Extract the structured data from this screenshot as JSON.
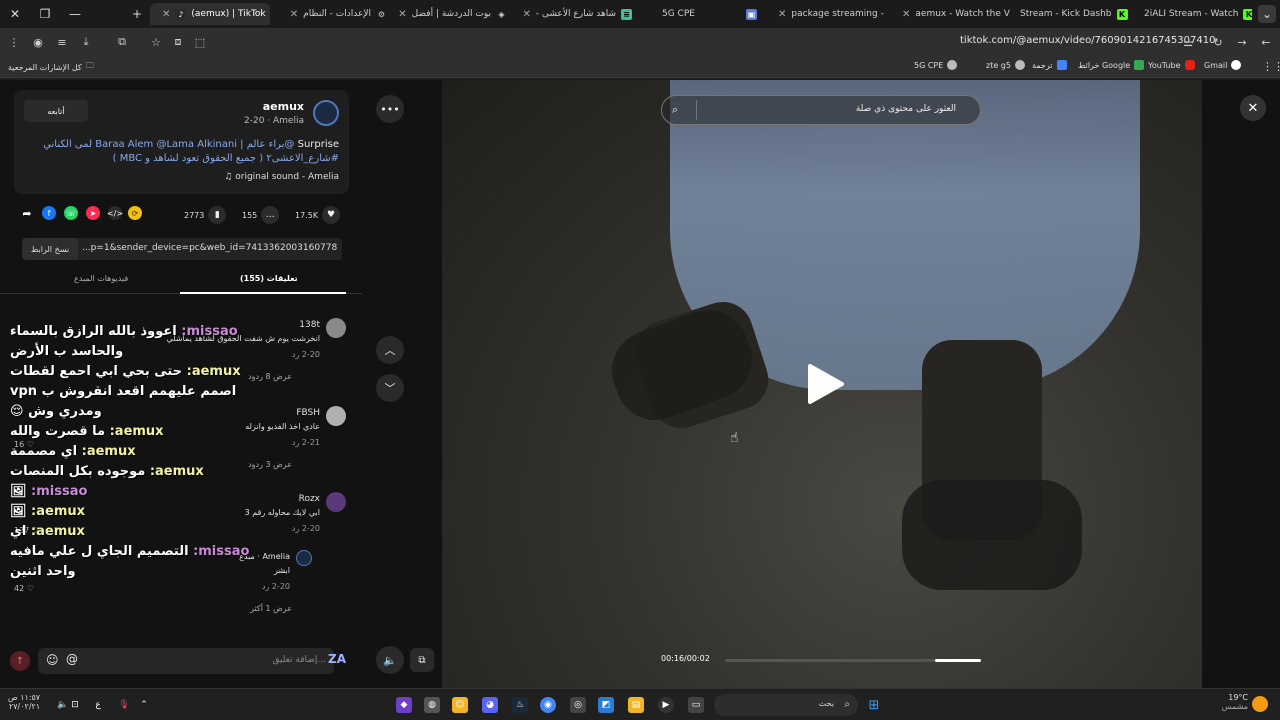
{
  "tabs": [
    {
      "title": "(aemux) | TikTok",
      "active": true
    },
    {
      "title": "الإعدادات - النظام"
    },
    {
      "title": "بوت الدردشة | أفضل"
    },
    {
      "title": "شاهد شارع الأعشى -"
    },
    {
      "title": "5G CPE"
    },
    {
      "title": "package streaming -"
    },
    {
      "title": "aemux - Watch the V"
    },
    {
      "title": "Stream - Kick Dashb"
    },
    {
      "title": "2iALI Stream - Watch"
    }
  ],
  "address": {
    "url": "tiktok.com/@aemux/video/7609014216745307410"
  },
  "bookmarks": {
    "all": "كل الإشارات المرجعية",
    "items": [
      "Gmail",
      "YouTube",
      "خرائط Google",
      "ترجمة",
      "zte g5",
      "5G CPE"
    ]
  },
  "post": {
    "follow_label": "أتابعه",
    "username": "aemux",
    "subline": "2-20 · Amelia",
    "desc_line1_plain": "Surprise ",
    "desc_line1_link": "@براء عالم | Baraa Alem @Lama Alkinani",
    "desc_line1_tail": " لمى الكناني",
    "desc_line2": "#شارع_الاعشى٢ ( جميع الحقوق تعود لشاهد و MBC )",
    "sound": "original sound - Amelia"
  },
  "actions": {
    "likes": "17.5K",
    "comments": "155",
    "saves": "2773"
  },
  "link": {
    "copy_label": "نسخ الرابط",
    "text": "...p=1&sender_device=pc&web_id=7413362003160778245"
  },
  "panel_tabs": {
    "comments": "تعليقات (155)",
    "creator_videos": "فيديوهات المبدع"
  },
  "comments": [
    {
      "user": "138t",
      "text": "انخرشت يوم ش شفت الحقوق لشاهد يماشلي",
      "date": "2-20",
      "reply": "رد",
      "more": "عرض 8 ردود"
    },
    {
      "user": "FBSH",
      "text": "عادي اخذ الفديو وانزله",
      "date": "2-21",
      "reply": "رد",
      "more": "عرض 3 ردود",
      "likes": "16"
    },
    {
      "user": "Rozx",
      "text": "ابي لايك محاوله رقم 3",
      "date": "2-20",
      "reply": "رد",
      "likes": "127"
    },
    {
      "user": "Amelia · مبدع",
      "text": "ابشر",
      "date": "2-20",
      "reply": "رد",
      "more": "عرض 1 أكثر",
      "likes": "42"
    }
  ],
  "chat_overlay": [
    {
      "name": "missao:",
      "msg": "اعووذ بالله الرازق بالسماء",
      "color": "purple"
    },
    {
      "name": "",
      "msg": "والحاسد ب الأرض",
      "color": "none"
    },
    {
      "name": "aemux:",
      "msg": "حتى بحي ابي احمع لقطات",
      "color": "yellow"
    },
    {
      "name": "",
      "msg": "اصمم عليهمم اقعد انقروش ب vpn",
      "color": "none"
    },
    {
      "name": "",
      "msg": "ومدري وش 😌",
      "color": "none"
    },
    {
      "name": "aemux:",
      "msg": "ما قصرت والله",
      "color": "yellow"
    },
    {
      "name": "aemux:",
      "msg": "اي مصممة",
      "color": "yellow"
    },
    {
      "name": "aemux:",
      "msg": "موجوده بكل المنصات",
      "color": "yellow"
    },
    {
      "name": "missao:",
      "msg": "🖼",
      "color": "purple"
    },
    {
      "name": "aemux:",
      "msg": "🖼",
      "color": "yellow"
    },
    {
      "name": "aemux:",
      "msg": "اي",
      "color": "yellow"
    },
    {
      "name": "missao:",
      "msg": "التصميم الجاي ل علي مافيه",
      "color": "purple"
    },
    {
      "name": "",
      "msg": "واحد اثنين",
      "color": "none"
    }
  ],
  "comment_input": {
    "placeholder": "إضافة تعليق..."
  },
  "player": {
    "search_placeholder": "العثور على محتوى ذي صلة",
    "time": "00:16/00:02",
    "progress": 0.18
  },
  "taskbar": {
    "weather_temp": "19°C",
    "weather_label": "مشمس",
    "search": "بحث",
    "time": "١١:٥٧ ص",
    "date": "٢٧/٠٢/٢١",
    "lang": "ع"
  }
}
